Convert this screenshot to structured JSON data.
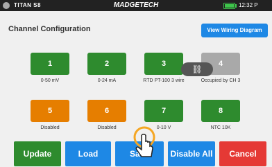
{
  "status_bar": {
    "device": "TITAN S8",
    "brand": "MADGETECH",
    "time": "12:32 P"
  },
  "page": {
    "title": "Channel Configuration",
    "wiring_button": "View Wiring Diagram"
  },
  "channels": [
    {
      "number": "1",
      "caption": "0-50 mV",
      "state": "active",
      "color": "#2e8b2e"
    },
    {
      "number": "2",
      "caption": "0-24 mA",
      "state": "active",
      "color": "#2e8b2e"
    },
    {
      "number": "3",
      "caption": "RTD PT-100 3 wire",
      "state": "active",
      "color": "#2e8b2e"
    },
    {
      "number": "4",
      "caption": "Occupied by CH 3",
      "state": "occupied",
      "color": "#a9a9a9"
    },
    {
      "number": "5",
      "caption": "Disabled",
      "state": "disabled",
      "color": "#e67e00"
    },
    {
      "number": "6",
      "caption": "Disabled",
      "state": "disabled",
      "color": "#e67e00"
    },
    {
      "number": "7",
      "caption": "0-10 V",
      "state": "active",
      "color": "#2e8b2e"
    },
    {
      "number": "8",
      "caption": "NTC 10K",
      "state": "active",
      "color": "#2e8b2e"
    }
  ],
  "link_icon": "link-icon",
  "buttons": {
    "update": "Update",
    "load": "Load",
    "save": "Save",
    "disable_all": "Disable All",
    "cancel": "Cancel"
  },
  "colors": {
    "update": "#2e8b2e",
    "load": "#1e88e5",
    "save": "#1e88e5",
    "disable_all": "#1e88e5",
    "cancel": "#e53935"
  }
}
